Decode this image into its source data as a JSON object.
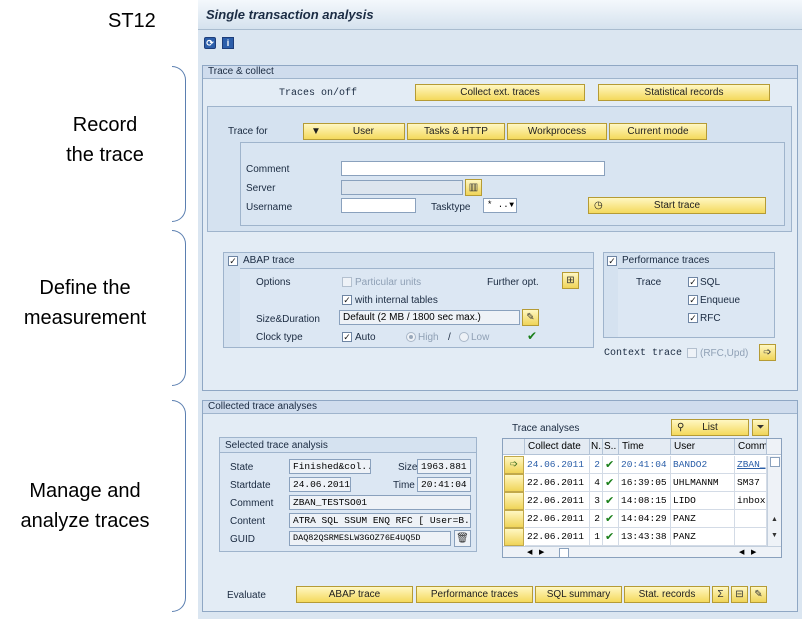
{
  "annotations": {
    "tcode": "ST12",
    "record": [
      "Record",
      "the trace"
    ],
    "define": [
      "Define the",
      "measurement"
    ],
    "manage": [
      "Manage and",
      "analyze traces"
    ]
  },
  "title": "Single transaction analysis",
  "toolbar": {
    "icons": [
      "refresh-icon",
      "info-icon"
    ],
    "info_glyph": "i"
  },
  "trace_collect": {
    "header": "Trace & collect",
    "traces_onoff": "Traces on/off",
    "collect_btn": "Collect ext. traces",
    "stat_btn": "Statistical records",
    "trace_for": "Trace for",
    "tabs": {
      "user": "User",
      "tasks": "Tasks & HTTP",
      "workprocess": "Workprocess",
      "current": "Current mode"
    },
    "comment_label": "Comment",
    "comment_value": "",
    "server_label": "Server",
    "server_value": "",
    "username_label": "Username",
    "username_value": "",
    "tasktype_label": "Tasktype",
    "tasktype_value": "* ..",
    "start_btn": "Start trace"
  },
  "abap": {
    "header": "ABAP trace",
    "options_label": "Options",
    "particular_units": "Particular units",
    "internal_tables": "with internal tables",
    "further_opt": "Further opt.",
    "size_label": "Size&Duration",
    "size_value": "Default (2 MB / 1800 sec max.)",
    "clock_label": "Clock type",
    "auto": "Auto",
    "high": "High",
    "slash": "/",
    "low": "Low"
  },
  "perf": {
    "header": "Performance traces",
    "trace_label": "Trace",
    "sql": "SQL",
    "enqueue": "Enqueue",
    "rfc": "RFC",
    "context": "Context trace",
    "context_opt": "(RFC,Upd)"
  },
  "collected": {
    "header": "Collected trace analyses",
    "selected_header": "Selected trace analysis",
    "state_label": "State",
    "state_value": "Finished&col..",
    "size_label": "Size",
    "size_value": "1963.881",
    "startdate_label": "Startdate",
    "startdate_value": "24.06.2011",
    "time_label": "Time",
    "time_value": "20:41:04",
    "comment_label": "Comment",
    "comment_value": "ZBAN_TESTSO01",
    "content_label": "Content",
    "content_value": "ATRA SQL SSUM ENQ RFC [ User=B..",
    "guid_label": "GUID",
    "guid_value": "DAQ82QSRMESLW3GOZ76E4UQ5D",
    "analyses_title": "Trace analyses",
    "list_btn": "List",
    "columns": [
      "Collect date",
      "N..",
      "S..",
      "Time",
      "User",
      "Comm"
    ],
    "rows": [
      {
        "date": "24.06.2011",
        "n": "2",
        "s": "✔",
        "time": "20:41:04",
        "user": "BANDO2",
        "comm": "ZBAN_"
      },
      {
        "date": "22.06.2011",
        "n": "4",
        "s": "✔",
        "time": "16:39:05",
        "user": "UHLMANNM",
        "comm": "SM37"
      },
      {
        "date": "22.06.2011",
        "n": "3",
        "s": "✔",
        "time": "14:08:15",
        "user": "LIDO",
        "comm": "inbox"
      },
      {
        "date": "22.06.2011",
        "n": "2",
        "s": "✔",
        "time": "14:04:29",
        "user": "PANZ",
        "comm": ""
      },
      {
        "date": "22.06.2011",
        "n": "1",
        "s": "✔",
        "time": "13:43:38",
        "user": "PANZ",
        "comm": ""
      }
    ],
    "evaluate_label": "Evaluate",
    "eval_btns": [
      "ABAP trace",
      "Performance traces",
      "SQL summary",
      "Stat. records"
    ]
  }
}
